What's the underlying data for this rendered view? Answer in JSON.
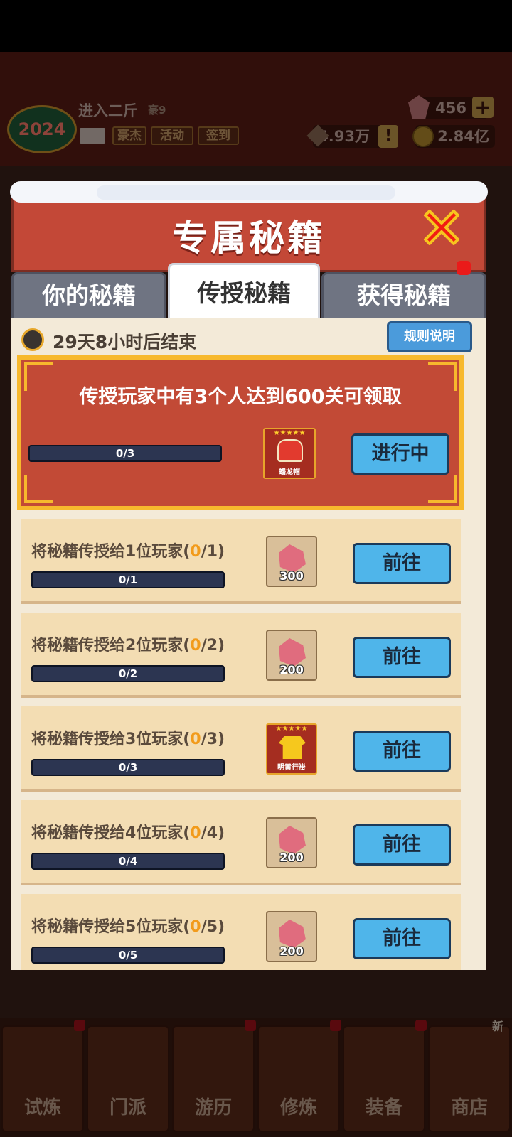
{
  "hud": {
    "player_name": "进入二斤",
    "vip_label": "豪9",
    "year_badge": "2024",
    "tags": [
      "豪杰",
      "活动",
      "签到"
    ],
    "gems": "456",
    "power": "4.93万",
    "gold": "2.84亿"
  },
  "dialog": {
    "title": "专属秘籍",
    "tabs": [
      "你的秘籍",
      "传授秘籍",
      "获得秘籍"
    ],
    "active_tab_index": 1,
    "timer_text": "29天8小时后结束",
    "rules_button": "规则说明",
    "feature": {
      "title": "传授玩家中有3个人达到600关可领取",
      "progress_text": "0/3",
      "progress_value": 0,
      "reward_label": "蟠龙帽",
      "reward_stars": "★★★★★",
      "button": "进行中"
    },
    "rows": [
      {
        "title": "将秘籍传授给1位玩家(",
        "count": "0",
        "total": "/1)",
        "progress": "0/1",
        "reward_type": "gem",
        "reward_amount": "300",
        "button": "前往"
      },
      {
        "title": "将秘籍传授给2位玩家(",
        "count": "0",
        "total": "/2)",
        "progress": "0/2",
        "reward_type": "gem",
        "reward_amount": "200",
        "button": "前往"
      },
      {
        "title": "将秘籍传授给3位玩家(",
        "count": "0",
        "total": "/3)",
        "progress": "0/3",
        "reward_type": "item",
        "reward_amount": "明黄行褂",
        "reward_stars": "★★★★★",
        "button": "前往"
      },
      {
        "title": "将秘籍传授给4位玩家(",
        "count": "0",
        "total": "/4)",
        "progress": "0/4",
        "reward_type": "gem",
        "reward_amount": "200",
        "button": "前往"
      },
      {
        "title": "将秘籍传授给5位玩家(",
        "count": "0",
        "total": "/5)",
        "progress": "0/5",
        "reward_type": "gem",
        "reward_amount": "200",
        "button": "前往"
      }
    ]
  },
  "bottom_nav": {
    "items": [
      "试炼",
      "门派",
      "游历",
      "修炼",
      "装备",
      "商店"
    ],
    "new_badge": "新"
  },
  "colors": {
    "dialog_red": "#c34837",
    "accent_gold": "#f7b92d",
    "button_blue": "#4fb5ea",
    "highlight_orange": "#f29b1b"
  }
}
